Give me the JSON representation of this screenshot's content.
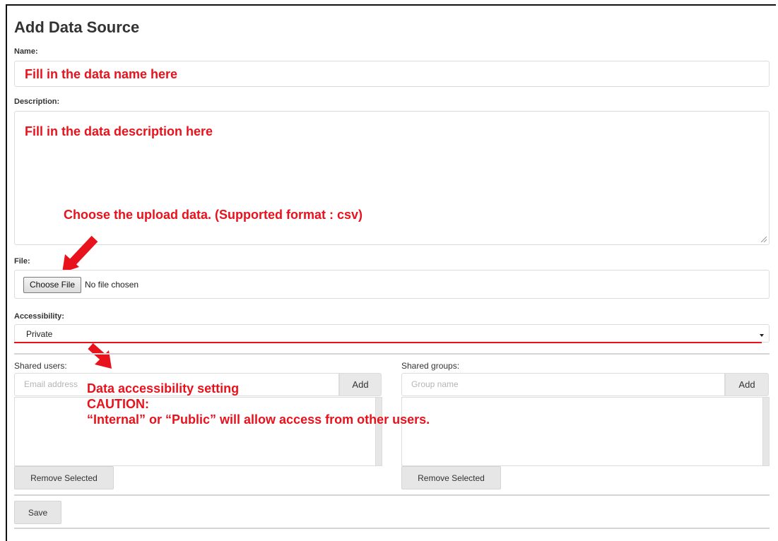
{
  "page": {
    "title": "Add Data Source"
  },
  "form": {
    "name_label": "Name:",
    "description_label": "Description:",
    "file_label": "File:",
    "choose_file_label": "Choose File",
    "file_status": "No file chosen",
    "accessibility_label": "Accessibility:",
    "accessibility_value": "Private",
    "shared_users_label": "Shared users:",
    "users_placeholder": "Email address",
    "users_add_label": "Add",
    "users_remove_label": "Remove Selected",
    "shared_groups_label": "Shared groups:",
    "groups_placeholder": "Group name",
    "groups_add_label": "Add",
    "groups_remove_label": "Remove Selected",
    "save_label": "Save"
  },
  "annotations": {
    "name_hint": "Fill in the data name here",
    "description_hint": "Fill in the data description here",
    "upload_hint": "Choose the upload data. (Supported format : csv)",
    "access_line1": "Data accessibility setting",
    "access_line2": "CAUTION:",
    "access_line3": "“Internal” or “Public” will allow access from other users."
  },
  "colors": {
    "annotation": "#e8121c",
    "text": "#333333",
    "border": "#dcdcdc",
    "button_gray": "#e6e6e6"
  },
  "icons": {
    "select_caret": "chevron-down-icon",
    "annotation_arrow": "arrow-icon",
    "resize_grip": "resize-grip-icon"
  }
}
